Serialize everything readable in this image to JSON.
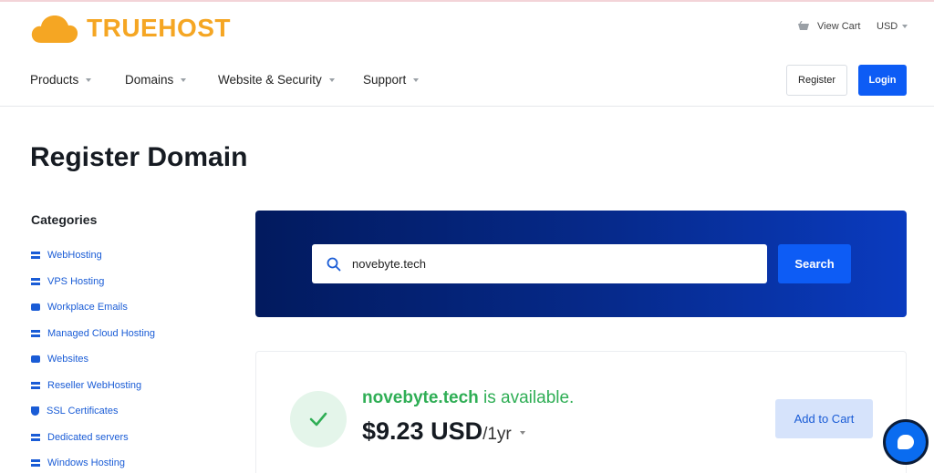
{
  "brand": {
    "name": "TRUEHOST",
    "color": "#f5a623"
  },
  "utility": {
    "cart_label": "View Cart",
    "currency": "USD"
  },
  "nav": {
    "items": [
      {
        "label": "Products"
      },
      {
        "label": "Domains"
      },
      {
        "label": "Website & Security"
      },
      {
        "label": "Support"
      }
    ],
    "register_label": "Register",
    "login_label": "Login"
  },
  "page": {
    "title": "Register Domain"
  },
  "sidebar": {
    "heading": "Categories",
    "items": [
      {
        "label": "WebHosting",
        "icon": "server-icon"
      },
      {
        "label": "VPS Hosting",
        "icon": "server-icon"
      },
      {
        "label": "Workplace Emails",
        "icon": "box-icon"
      },
      {
        "label": "Managed Cloud Hosting",
        "icon": "server-icon"
      },
      {
        "label": "Websites",
        "icon": "box-icon"
      },
      {
        "label": "Reseller WebHosting",
        "icon": "server-icon"
      },
      {
        "label": "SSL Certificates",
        "icon": "shield-icon"
      },
      {
        "label": "Dedicated servers",
        "icon": "server-icon"
      },
      {
        "label": "Windows Hosting",
        "icon": "server-icon"
      }
    ]
  },
  "search": {
    "value": "novebyte.tech",
    "button_label": "Search"
  },
  "result": {
    "domain": "novebyte.tech",
    "status_text": " is available.",
    "price": "$9.23 USD",
    "period": "/1yr",
    "add_to_cart_label": "Add to Cart"
  },
  "colors": {
    "primary": "#0d5cf5",
    "success": "#2fae55",
    "banner_dark": "#021a5e"
  }
}
